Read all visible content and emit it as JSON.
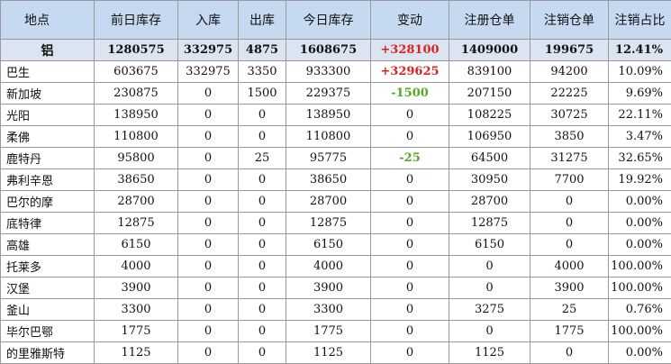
{
  "table": {
    "headers": [
      "地点",
      "前日库存",
      "入库",
      "出库",
      "今日库存",
      "变动",
      "注册仓单",
      "注销仓单",
      "注销占比"
    ],
    "summary": {
      "place": "铝",
      "prev": "1280575",
      "in": "332975",
      "out": "4875",
      "today": "1608675",
      "change": "+328100",
      "change_sign": "pos",
      "reg": "1409000",
      "cancel": "199675",
      "pct": "12.41%"
    },
    "rows": [
      {
        "place": "巴生",
        "prev": "603675",
        "in": "332975",
        "out": "3350",
        "today": "933300",
        "change": "+329625",
        "change_sign": "pos",
        "reg": "839100",
        "cancel": "94200",
        "pct": "10.09%"
      },
      {
        "place": "新加坡",
        "prev": "230875",
        "in": "0",
        "out": "1500",
        "today": "229375",
        "change": "-1500",
        "change_sign": "neg",
        "reg": "207150",
        "cancel": "22225",
        "pct": "9.69%"
      },
      {
        "place": "光阳",
        "prev": "138950",
        "in": "0",
        "out": "0",
        "today": "138950",
        "change": "0",
        "change_sign": "zero",
        "reg": "108225",
        "cancel": "30725",
        "pct": "22.11%"
      },
      {
        "place": "柔佛",
        "prev": "110800",
        "in": "0",
        "out": "0",
        "today": "110800",
        "change": "0",
        "change_sign": "zero",
        "reg": "106950",
        "cancel": "3850",
        "pct": "3.47%"
      },
      {
        "place": "鹿特丹",
        "prev": "95800",
        "in": "0",
        "out": "25",
        "today": "95775",
        "change": "-25",
        "change_sign": "neg",
        "reg": "64500",
        "cancel": "31275",
        "pct": "32.65%"
      },
      {
        "place": "弗利辛恩",
        "prev": "38650",
        "in": "0",
        "out": "0",
        "today": "38650",
        "change": "0",
        "change_sign": "zero",
        "reg": "30950",
        "cancel": "7700",
        "pct": "19.92%"
      },
      {
        "place": "巴尔的摩",
        "prev": "28700",
        "in": "0",
        "out": "0",
        "today": "28700",
        "change": "0",
        "change_sign": "zero",
        "reg": "28700",
        "cancel": "0",
        "pct": "0.00%"
      },
      {
        "place": "底特律",
        "prev": "12875",
        "in": "0",
        "out": "0",
        "today": "12875",
        "change": "0",
        "change_sign": "zero",
        "reg": "12875",
        "cancel": "0",
        "pct": "0.00%"
      },
      {
        "place": "高雄",
        "prev": "6150",
        "in": "0",
        "out": "0",
        "today": "6150",
        "change": "0",
        "change_sign": "zero",
        "reg": "6150",
        "cancel": "0",
        "pct": "0.00%"
      },
      {
        "place": "托莱多",
        "prev": "4000",
        "in": "0",
        "out": "0",
        "today": "4000",
        "change": "0",
        "change_sign": "zero",
        "reg": "0",
        "cancel": "4000",
        "pct": "100.00%"
      },
      {
        "place": "汉堡",
        "prev": "3900",
        "in": "0",
        "out": "0",
        "today": "3900",
        "change": "0",
        "change_sign": "zero",
        "reg": "0",
        "cancel": "3900",
        "pct": "100.00%"
      },
      {
        "place": "釜山",
        "prev": "3300",
        "in": "0",
        "out": "0",
        "today": "3300",
        "change": "0",
        "change_sign": "zero",
        "reg": "3275",
        "cancel": "25",
        "pct": "0.76%"
      },
      {
        "place": "毕尔巴鄂",
        "prev": "1775",
        "in": "0",
        "out": "0",
        "today": "1775",
        "change": "0",
        "change_sign": "zero",
        "reg": "0",
        "cancel": "1775",
        "pct": "100.00%"
      },
      {
        "place": "的里雅斯特",
        "prev": "1125",
        "in": "0",
        "out": "0",
        "today": "1125",
        "change": "0",
        "change_sign": "zero",
        "reg": "1125",
        "cancel": "0",
        "pct": "0.00%"
      }
    ]
  },
  "colors": {
    "header_bg": "#c5d9f1",
    "summary_bg": "#dbe5f1",
    "positive": "#e02020",
    "negative": "#55aa22",
    "grid": "#9a9a9a"
  }
}
